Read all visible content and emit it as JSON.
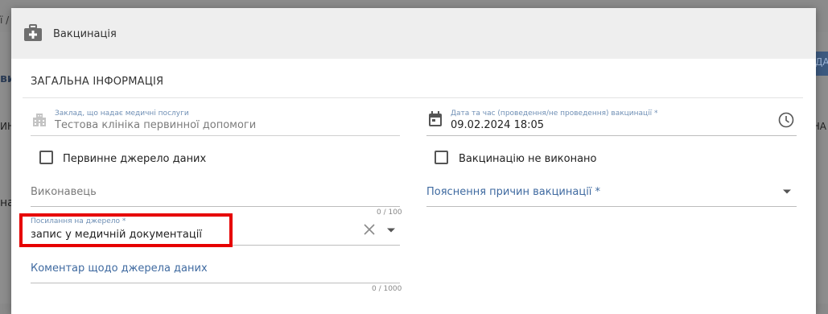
{
  "background": {
    "fragments": [
      "ї /",
      "ви",
      "ИН",
      "на",
      "ДА",
      "НА"
    ]
  },
  "dialog": {
    "title": "Вакцинація",
    "section_title": "ЗАГАЛЬНА ІНФОРМАЦІЯ",
    "facility": {
      "label": "Заклад, що надає медичні послуги",
      "value": "Тестова клініка первинної допомоги"
    },
    "datetime": {
      "label": "Дата та час (проведення/не проведення) вакцинації *",
      "value": "09.02.2024 18:05"
    },
    "primary_source": {
      "label": "Первинне джерело даних",
      "checked": false
    },
    "not_performed": {
      "label": "Вакцинацію не виконано",
      "checked": false
    },
    "performer": {
      "placeholder": "Виконавець",
      "counter": "0 / 100"
    },
    "reason": {
      "placeholder": "Пояснення причин вакцинації *"
    },
    "source_ref": {
      "label": "Посилання на джерело *",
      "value": "запис у медичній документації"
    },
    "source_comment": {
      "placeholder": "Коментар щодо джерела даних",
      "counter": "0 / 1000"
    }
  },
  "colors": {
    "accent": "#3f6aa0",
    "highlight": "#e60000",
    "header_bg": "#eeeeee"
  }
}
